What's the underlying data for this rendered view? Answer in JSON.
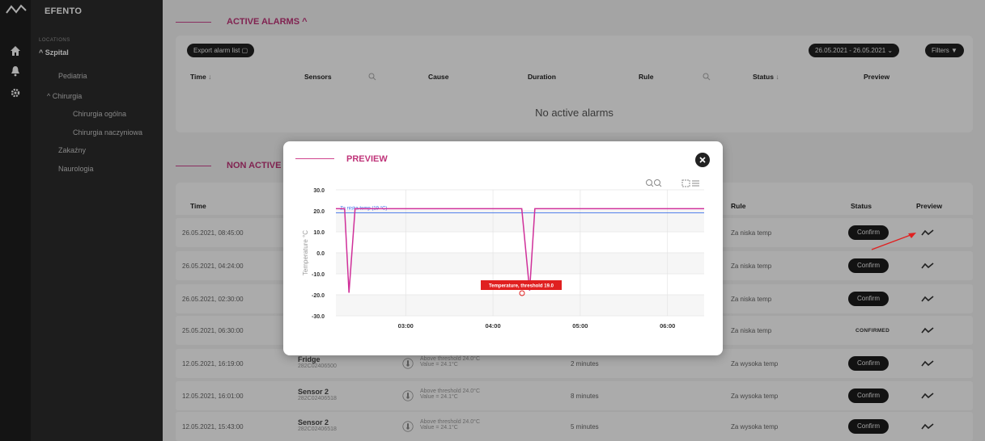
{
  "app": {
    "brand": "EFENTO"
  },
  "sidebar": {
    "section": "LOCATIONS",
    "items": [
      {
        "label": "^  Szpital",
        "bold": true
      },
      {
        "label": "Pediatria"
      },
      {
        "label": "^  Chirurgia"
      },
      {
        "label": "Chirurgia ogólna"
      },
      {
        "label": "Chirurgia naczyniowa"
      },
      {
        "label": "Zakaźny"
      },
      {
        "label": "Naurologia"
      }
    ]
  },
  "active_alarms": {
    "title": "ACTIVE ALARMS ^",
    "export_label": "Export alarm list",
    "date_range": "26.05.2021 - 26.05.2021",
    "filters_label": "Filters",
    "columns": [
      "Time",
      "Sensors",
      "Cause",
      "Duration",
      "Rule",
      "Status",
      "Preview"
    ],
    "empty_text": "No active alarms"
  },
  "non_active_alarms": {
    "title": "NON ACTIVE",
    "columns": [
      "Time",
      "Rule",
      "Status",
      "Preview"
    ],
    "rows": [
      {
        "time": "26.05.2021, 08:45:00",
        "rule": "Za niska temp",
        "status": "Confirm"
      },
      {
        "time": "26.05.2021, 04:24:00",
        "rule": "Za niska temp",
        "status": "Confirm"
      },
      {
        "time": "26.05.2021, 02:30:00",
        "rule": "Za niska temp",
        "status": "Confirm"
      },
      {
        "time": "25.05.2021, 06:30:00",
        "rule": "Za niska temp",
        "status": "CONFIRMED"
      },
      {
        "time": "12.05.2021, 16:19:00",
        "sensor": "Fridge",
        "sensor_id": "282C02406500",
        "cause": "Above threshold 24.0°C",
        "value": "Value = 24.1°C",
        "duration": "2 minutes",
        "rule": "Za wysoka temp",
        "status": "Confirm"
      },
      {
        "time": "12.05.2021, 16:01:00",
        "sensor": "Sensor 2",
        "sensor_id": "282C02406518",
        "cause": "Above threshold 24.0°C",
        "value": "Value = 24.1°C",
        "duration": "8 minutes",
        "rule": "Za wysoka temp",
        "status": "Confirm"
      },
      {
        "time": "12.05.2021, 15:43:00",
        "sensor": "Sensor 2",
        "sensor_id": "282C02406518",
        "cause": "Above threshold 24.0°C",
        "value": "Value = 24.1°C",
        "duration": "5 minutes",
        "rule": "Za wysoka temp",
        "status": "Confirm"
      }
    ]
  },
  "preview_modal": {
    "title": "PREVIEW",
    "threshold_label": "Za niska temp (19 °C)",
    "tooltip": "Temperature, threshold 19.0"
  },
  "chart_data": {
    "type": "line",
    "ylabel": "Temperature °C",
    "xlabel": "",
    "ylim": [
      -30,
      30
    ],
    "yticks": [
      30.0,
      20.0,
      10.0,
      0.0,
      -10.0,
      -20.0,
      -30.0
    ],
    "xticks": [
      "03:00",
      "04:00",
      "05:00",
      "06:00"
    ],
    "x_hours_range": [
      2.2,
      6.42
    ],
    "series": [
      {
        "color": "#d0309a",
        "x_hours": [
          2.2,
          2.3,
          2.35,
          2.42,
          2.48,
          4.2,
          4.33,
          4.42,
          4.48,
          6.42
        ],
        "y": [
          21,
          21,
          -19,
          21,
          21,
          21,
          21,
          -18,
          21,
          21
        ]
      }
    ],
    "threshold": {
      "y": 19,
      "color": "#3a6ee8"
    }
  },
  "colors": {
    "accent": "#c0357a",
    "dark": "#1c1c1c",
    "threshold": "#3a6ee8",
    "tooltip": "#e02020",
    "arrow": "#e02020"
  }
}
